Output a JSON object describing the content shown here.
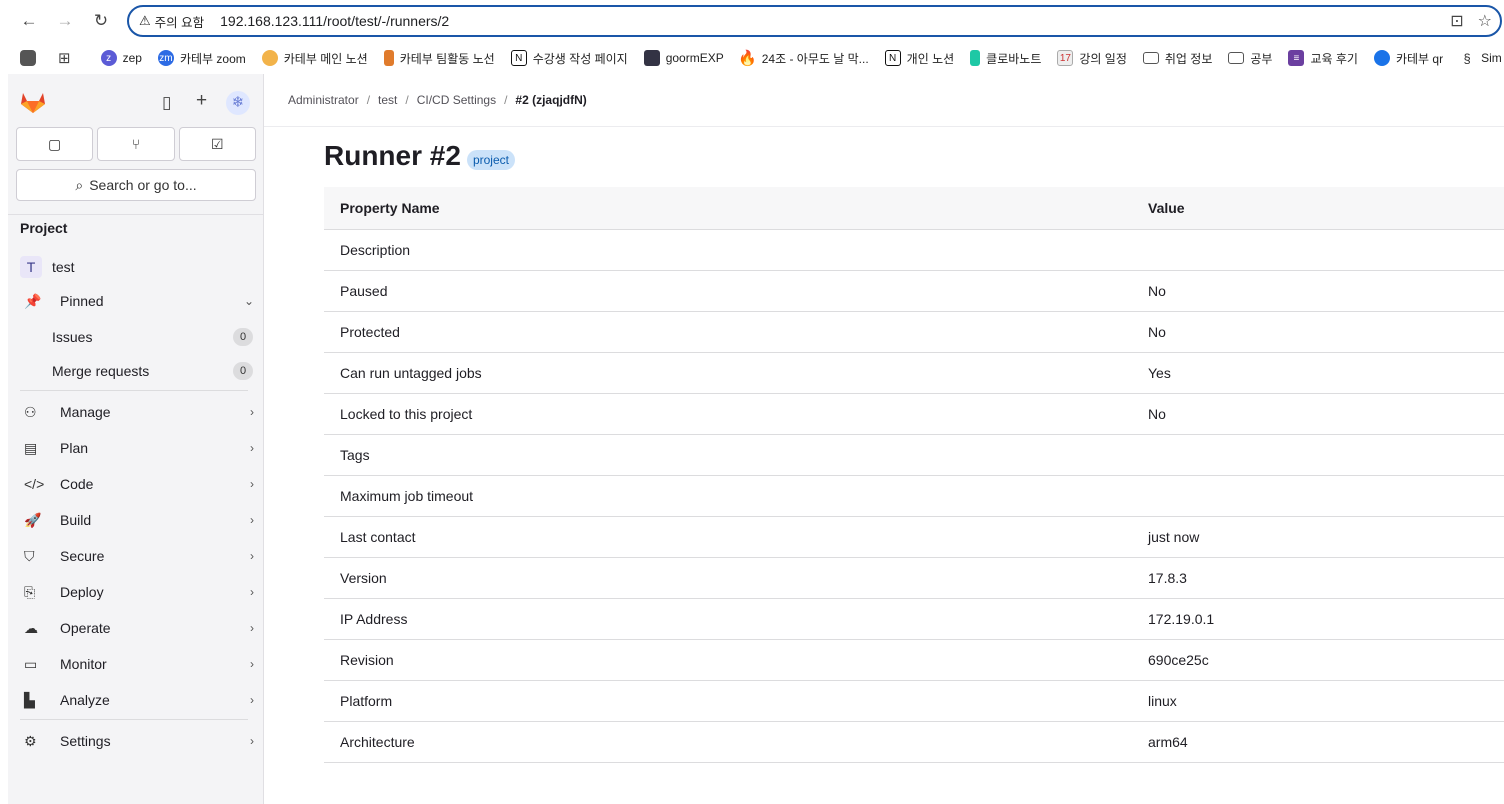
{
  "browser": {
    "security_label": "주의 요함",
    "url": "192.168.123.111/root/test/-/runners/2",
    "bookmarks": [
      {
        "label": "",
        "icon": "apps-icon",
        "color": "#555"
      },
      {
        "label": "zep",
        "icon": "zep-icon",
        "color": "#5b5bd6"
      },
      {
        "label": "카테부 zoom",
        "icon": "zoom-icon",
        "color": "#2d6be4"
      },
      {
        "label": "카테부 메인 노션",
        "icon": "notion-emoji-icon",
        "color": "#f2b34a"
      },
      {
        "label": "카테부 팀활동 노선",
        "icon": "bookmark-icon",
        "color": "#e07b2c"
      },
      {
        "label": "수강생 작성 페이지",
        "icon": "notion-icon",
        "color": "#111"
      },
      {
        "label": "goormEXP",
        "icon": "goorm-icon",
        "color": "#334"
      },
      {
        "label": "24조 - 아무도 날 막...",
        "icon": "fire-icon",
        "color": "#f05a24"
      },
      {
        "label": "개인 노션",
        "icon": "notion-icon",
        "color": "#111"
      },
      {
        "label": "클로바노트",
        "icon": "clova-icon",
        "color": "#1ec8a5"
      },
      {
        "label": "강의 일정",
        "icon": "calendar-icon",
        "color": "#aaa"
      },
      {
        "label": "취업 정보",
        "icon": "folder-icon",
        "color": "#555"
      },
      {
        "label": "공부",
        "icon": "folder-icon",
        "color": "#555"
      },
      {
        "label": "교육 후기",
        "icon": "form-icon",
        "color": "#6b3fa0"
      },
      {
        "label": "카테부 qr",
        "icon": "qr-icon",
        "color": "#1a73e8"
      },
      {
        "label": "Sim",
        "icon": "sim-icon",
        "color": "#333"
      }
    ]
  },
  "sidebar": {
    "search_label": "Search or go to...",
    "section_heading": "Project",
    "project": {
      "initial": "T",
      "name": "test"
    },
    "pinned_label": "Pinned",
    "pinned_items": [
      {
        "label": "Issues",
        "count": "0"
      },
      {
        "label": "Merge requests",
        "count": "0"
      }
    ],
    "nav_items": [
      {
        "label": "Manage",
        "icon": "users-icon"
      },
      {
        "label": "Plan",
        "icon": "calendar-icon"
      },
      {
        "label": "Code",
        "icon": "code-icon"
      },
      {
        "label": "Build",
        "icon": "rocket-icon"
      },
      {
        "label": "Secure",
        "icon": "shield-icon"
      },
      {
        "label": "Deploy",
        "icon": "deploy-icon"
      },
      {
        "label": "Operate",
        "icon": "cloud-icon"
      },
      {
        "label": "Monitor",
        "icon": "monitor-icon"
      },
      {
        "label": "Analyze",
        "icon": "chart-icon"
      }
    ],
    "settings_label": "Settings"
  },
  "breadcrumb": [
    "Administrator",
    "test",
    "CI/CD Settings",
    "#2 (zjaqjdfN)"
  ],
  "page": {
    "title": "Runner #2",
    "badge": "project"
  },
  "table": {
    "headers": [
      "Property Name",
      "Value"
    ],
    "rows": [
      [
        "Description",
        ""
      ],
      [
        "Paused",
        "No"
      ],
      [
        "Protected",
        "No"
      ],
      [
        "Can run untagged jobs",
        "Yes"
      ],
      [
        "Locked to this project",
        "No"
      ],
      [
        "Tags",
        ""
      ],
      [
        "Maximum job timeout",
        ""
      ],
      [
        "Last contact",
        "just now"
      ],
      [
        "Version",
        "17.8.3"
      ],
      [
        "IP Address",
        "172.19.0.1"
      ],
      [
        "Revision",
        "690ce25c"
      ],
      [
        "Platform",
        "linux"
      ],
      [
        "Architecture",
        "arm64"
      ]
    ]
  }
}
